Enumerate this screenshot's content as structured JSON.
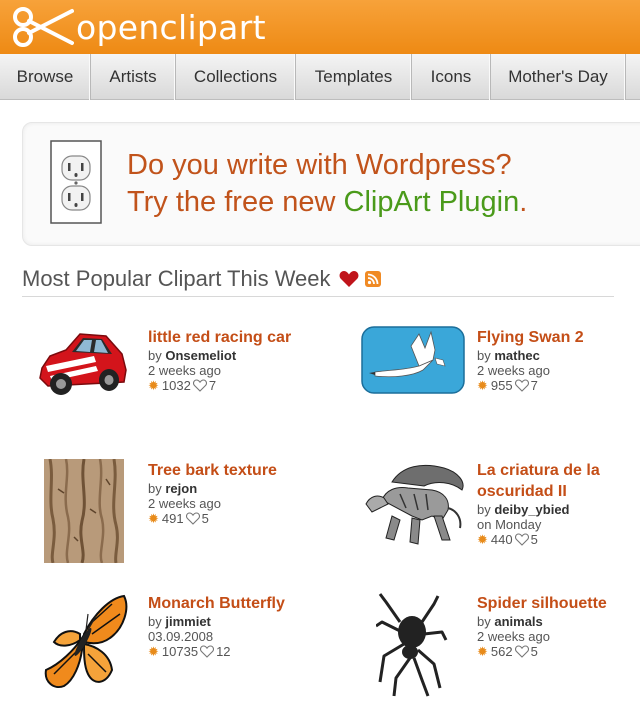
{
  "header": {
    "logo_text": "openclipart"
  },
  "nav": {
    "items": [
      "Browse",
      "Artists",
      "Collections",
      "Templates",
      "Icons",
      "Mother's Day"
    ]
  },
  "banner": {
    "line1": "Do you write with Wordpress?",
    "line2_prefix": "Try the free new ",
    "line2_link": "ClipArt Plugin",
    "line2_suffix": "."
  },
  "section": {
    "title": "Most Popular Clipart This Week"
  },
  "items": [
    {
      "title": "little red racing car",
      "by": "by",
      "author": "Onsemeliot",
      "date": "2 weeks ago",
      "stars": "1032",
      "likes": "7"
    },
    {
      "title": "Flying Swan 2",
      "by": "by",
      "author": "mathec",
      "date": "2 weeks ago",
      "stars": "955",
      "likes": "7"
    },
    {
      "title": "Tree bark texture",
      "by": "by",
      "author": "rejon",
      "date": "2 weeks ago",
      "stars": "491",
      "likes": "5"
    },
    {
      "title": "La criatura de la",
      "title2": "oscuridad II",
      "by": "by",
      "author": "deiby_ybied",
      "date": "on Monday",
      "stars": "440",
      "likes": "5"
    },
    {
      "title": "Monarch Butterfly",
      "by": "by",
      "author": "jimmiet",
      "date": "03.09.2008",
      "stars": "10735",
      "likes": "12"
    },
    {
      "title": "Spider silhouette",
      "by": "by",
      "author": "animals",
      "date": "2 weeks ago",
      "stars": "562",
      "likes": "5"
    }
  ],
  "colors": {
    "header": "#ee8a14",
    "title": "#c44e17",
    "link_green": "#4a9a1a"
  }
}
